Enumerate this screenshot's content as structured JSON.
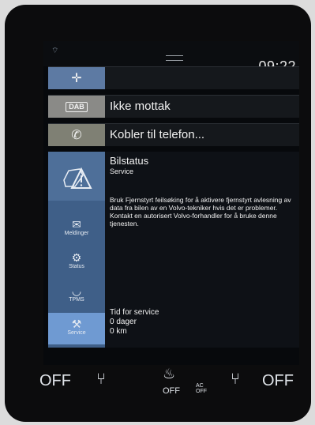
{
  "status": {
    "time": "09:22"
  },
  "tiles": {
    "nav": {
      "label": ""
    },
    "radio": {
      "badge": "DAB",
      "label": "Ikke mottak"
    },
    "phone": {
      "label": "Kobler til telefon..."
    }
  },
  "sidebar": {
    "items": [
      {
        "label": "Meldinger"
      },
      {
        "label": "Status"
      },
      {
        "label": "TPMS"
      },
      {
        "label": "Service"
      }
    ]
  },
  "content": {
    "title": "Bilstatus",
    "subtitle": "Service",
    "body": "Bruk Fjernstyrt feilsøking for å aktivere fjernstyrt avlesning av data fra bilen av en Volvo-tekniker hvis det er problemer. Kontakt en autorisert Volvo-forhandler for å bruke denne tjenesten.",
    "service": {
      "label": "Tid for service",
      "days": "0 dager",
      "km": "0 km"
    }
  },
  "climate": {
    "left_temp": "OFF",
    "right_temp": "OFF",
    "mid_off": "OFF",
    "ac_label": "AC",
    "ac_state": "OFF"
  }
}
